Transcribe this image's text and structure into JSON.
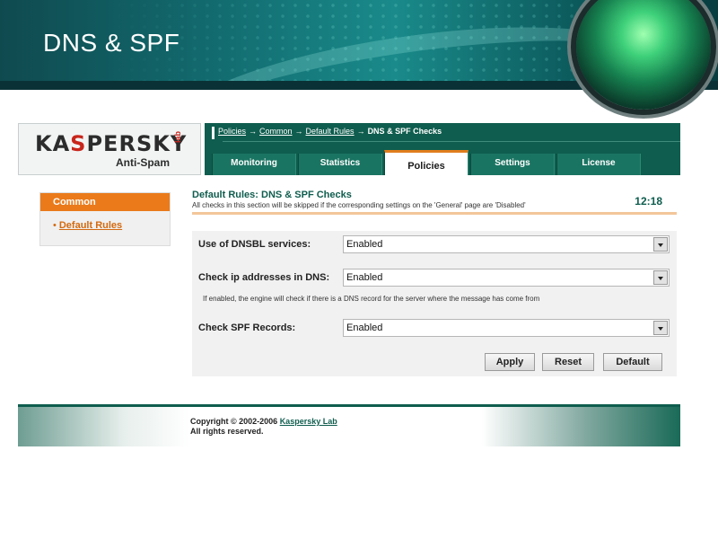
{
  "slide": {
    "title": "DNS & SPF"
  },
  "brand": {
    "logo_text_a": "KA",
    "logo_text_b": "S",
    "logo_text_c": "PER",
    "logo_text_d": "SKY",
    "logo_lab": "lab",
    "product": "Anti-Spam"
  },
  "breadcrumb": {
    "items": [
      "Policies",
      "Common",
      "Default Rules"
    ],
    "separator": "→",
    "current": "DNS & SPF Checks"
  },
  "tabs": [
    {
      "label": "Monitoring",
      "active": false
    },
    {
      "label": "Statistics",
      "active": false
    },
    {
      "label": "Policies",
      "active": true
    },
    {
      "label": "Settings",
      "active": false
    },
    {
      "label": "License",
      "active": false
    }
  ],
  "sidebar": {
    "header": "Common",
    "items": [
      {
        "bullet": "•",
        "label": "Default Rules"
      }
    ]
  },
  "content": {
    "title": "Default Rules: DNS & SPF Checks",
    "note": "All checks in this section will be skipped if the corresponding settings on the 'General' page are 'Disabled'",
    "clock": "12:18"
  },
  "form": {
    "dnsbl": {
      "label": "Use of DNSBL services:",
      "value": "Enabled"
    },
    "ip_dns": {
      "label": "Check ip addresses in DNS:",
      "value": "Enabled"
    },
    "ip_hint": "If enabled, the engine will check if there is a DNS record for the server where the message has come from",
    "spf": {
      "label": "Check SPF Records:",
      "value": "Enabled"
    }
  },
  "buttons": {
    "apply": "Apply",
    "reset": "Reset",
    "default": "Default"
  },
  "footer": {
    "copyright_prefix": "Copyright © 2002-2006",
    "company": "Kaspersky Lab",
    "rights": "All rights reserved."
  },
  "colors": {
    "brand_green": "#0f5d4e",
    "accent_orange": "#ea7a1a",
    "logo_red": "#c8261c"
  }
}
